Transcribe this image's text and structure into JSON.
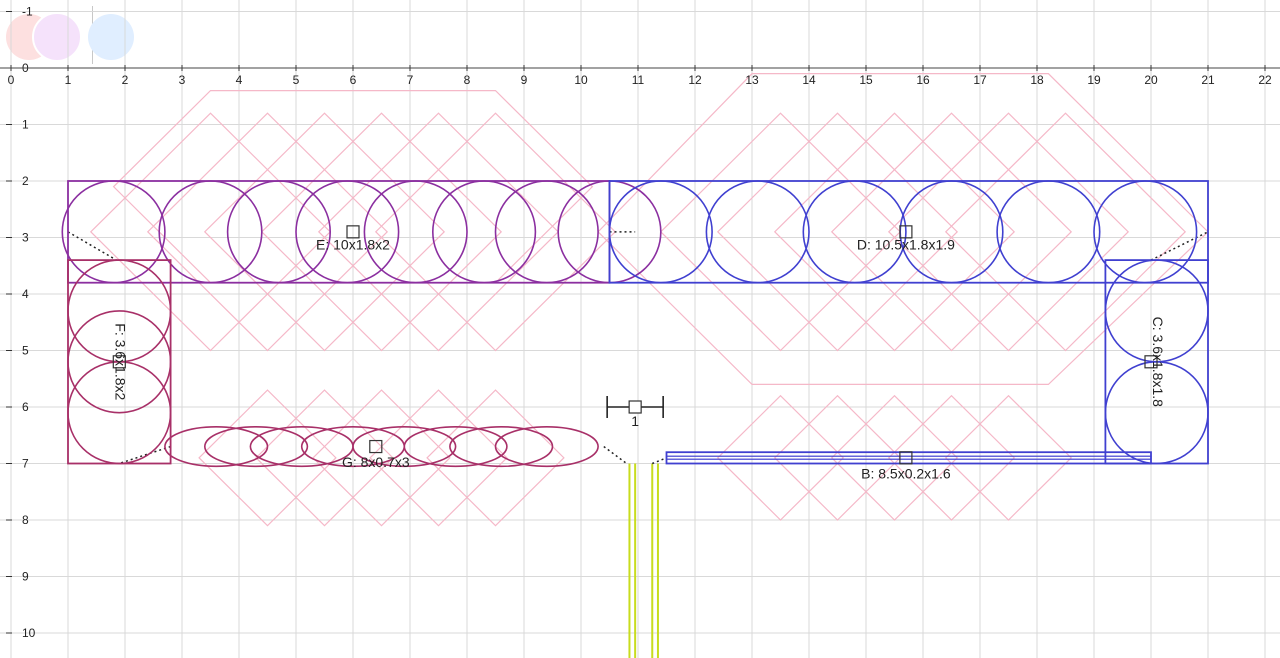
{
  "axes": {
    "x_ticks": [
      "0",
      "1",
      "2",
      "3",
      "4",
      "5",
      "6",
      "7",
      "8",
      "9",
      "10",
      "11",
      "12",
      "13",
      "14",
      "15",
      "16",
      "17",
      "18",
      "19",
      "20",
      "21",
      "22"
    ],
    "y_ticks": [
      "-1",
      "0",
      "1",
      "2",
      "3",
      "4",
      "5",
      "6",
      "7",
      "8",
      "9",
      "10"
    ],
    "x_range": [
      0,
      22.3
    ],
    "y_range": [
      -1.2,
      10.4
    ],
    "grid": true
  },
  "units": [
    {
      "id": "E",
      "label": "E: 10x1.8x2",
      "color": "#8b2fa0",
      "rect": [
        1,
        2,
        10.5,
        3.8
      ],
      "handle": [
        6,
        2.9
      ],
      "label_pos": [
        6,
        3.15
      ],
      "circles": {
        "cx": [
          1.8,
          3.5,
          4.7,
          5.9,
          7.1,
          8.3,
          9.4,
          10.5
        ],
        "cy": 2.9,
        "rx": 0.9,
        "ry": 0.9
      }
    },
    {
      "id": "D",
      "label": "D: 10.5x1.8x1.9",
      "color": "#4040d0",
      "rect": [
        10.5,
        2,
        21,
        3.8
      ],
      "handle": [
        15.7,
        2.9
      ],
      "label_pos": [
        15.7,
        3.15
      ],
      "circles": {
        "cx": [
          11.4,
          13.1,
          14.8,
          16.5,
          18.2,
          19.9
        ],
        "cy": 2.9,
        "rx": 0.9,
        "ry": 0.9
      }
    },
    {
      "id": "C",
      "label": "C: 3.6x1.8x1.8",
      "color": "#4040d0",
      "rect": [
        19.2,
        3.4,
        21,
        7
      ],
      "handle": [
        20,
        5.2
      ],
      "label_pos": [
        20.1,
        5.2
      ],
      "vertical": true,
      "circles": {
        "cx": [
          20.1,
          20.1
        ],
        "cy_list": [
          4.3,
          6.1
        ],
        "rx": 0.9,
        "ry": 0.9
      }
    },
    {
      "id": "F",
      "label": "F: 3.6x1.8x2",
      "color": "#a83068",
      "rect": [
        1,
        3.4,
        2.8,
        7
      ],
      "handle": [
        1.9,
        5.2
      ],
      "label_pos": [
        1.9,
        5.2
      ],
      "vertical": true,
      "circles": {
        "cx": [
          1.9,
          1.9,
          1.9
        ],
        "cy_list": [
          4.3,
          5.2,
          6.1
        ],
        "rx": 0.9,
        "ry": 0.9
      }
    },
    {
      "id": "G",
      "label": "G: 8x0.7x3",
      "color": "#a83068",
      "rect": null,
      "handle": [
        6.4,
        6.7
      ],
      "label_pos": [
        6.4,
        7.0
      ],
      "circles": {
        "cx": [
          3.6,
          4.3,
          5.1,
          6.0,
          6.9,
          7.8,
          8.6,
          9.4
        ],
        "cy": 6.7,
        "rx": 0.9,
        "ry": 0.35
      }
    },
    {
      "id": "B",
      "label": "B: 8.5x0.2x1.6",
      "color": "#4040d0",
      "rect": [
        11.5,
        6.8,
        20,
        7
      ],
      "handle": [
        15.7,
        6.9
      ],
      "label_pos": [
        15.7,
        7.2
      ],
      "circles": null
    }
  ],
  "door": {
    "label": "1",
    "center": [
      10.95,
      6.0
    ]
  },
  "connector_color": "#c8dc1e",
  "shadow_color": "#f5b8c8"
}
